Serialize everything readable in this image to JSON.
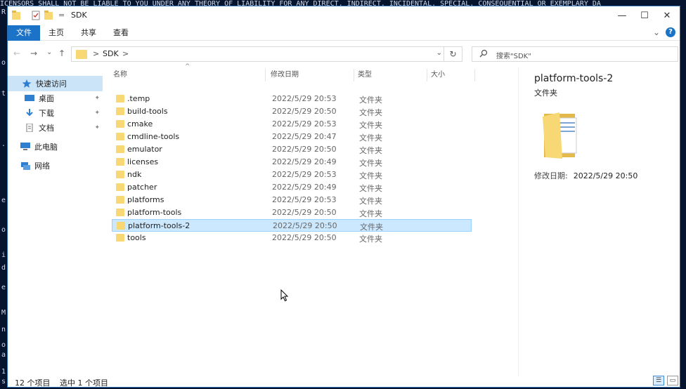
{
  "background_terminal": {
    "line": "ICENSORS SHALL NOT BE LIABLE TO YOU UNDER ANY THEORY OF LIABILITY FOR ANY DIRECT, INDIRECT, INCIDENTAL, SPECIAL, CONSEQUENTIAL OR EXEMPLARY DA",
    "left_chars": [
      "R",
      "o",
      "t",
      ".",
      "e",
      "o",
      "i",
      "d",
      "e",
      "M",
      "n",
      "o",
      "a",
      "1",
      "s"
    ]
  },
  "window": {
    "title": "SDK",
    "minimize": "—",
    "maximize": "☐",
    "close": "✕",
    "qa_dropdown": "="
  },
  "ribbon": {
    "tabs": [
      "文件",
      "主页",
      "共享",
      "查看"
    ],
    "expand_icon": "⌄",
    "help_label": "?"
  },
  "navigation": {
    "back": "←",
    "forward": "→",
    "recent": "⌄",
    "up": "↑",
    "path_sep": ">",
    "path": "SDK",
    "path_sep2": ">",
    "dropdown": "⌄",
    "refresh": "↻",
    "search_placeholder": "搜索\"SDK\""
  },
  "sidebar": {
    "items": [
      {
        "label": "快速访问",
        "icon": "star-icon"
      },
      {
        "label": "桌面",
        "icon": "desktop-icon"
      },
      {
        "label": "下载",
        "icon": "download-icon"
      },
      {
        "label": "文档",
        "icon": "document-icon"
      },
      {
        "label": "此电脑",
        "icon": "computer-icon"
      },
      {
        "label": "网络",
        "icon": "network-icon"
      }
    ]
  },
  "columns": {
    "name": "名称",
    "date": "修改日期",
    "type": "类型",
    "size": "大小",
    "sort_icon": "^"
  },
  "files": [
    {
      "name": ".temp",
      "date": "2022/5/29 20:53",
      "type": "文件夹"
    },
    {
      "name": "build-tools",
      "date": "2022/5/29 20:50",
      "type": "文件夹"
    },
    {
      "name": "cmake",
      "date": "2022/5/29 20:53",
      "type": "文件夹"
    },
    {
      "name": "cmdline-tools",
      "date": "2022/5/29 20:47",
      "type": "文件夹"
    },
    {
      "name": "emulator",
      "date": "2022/5/29 20:50",
      "type": "文件夹"
    },
    {
      "name": "licenses",
      "date": "2022/5/29 20:49",
      "type": "文件夹"
    },
    {
      "name": "ndk",
      "date": "2022/5/29 20:53",
      "type": "文件夹"
    },
    {
      "name": "patcher",
      "date": "2022/5/29 20:49",
      "type": "文件夹"
    },
    {
      "name": "platforms",
      "date": "2022/5/29 20:53",
      "type": "文件夹"
    },
    {
      "name": "platform-tools",
      "date": "2022/5/29 20:50",
      "type": "文件夹"
    },
    {
      "name": "platform-tools-2",
      "date": "2022/5/29 20:50",
      "type": "文件夹",
      "selected": true
    },
    {
      "name": "tools",
      "date": "2022/5/29 20:50",
      "type": "文件夹"
    }
  ],
  "preview": {
    "name": "platform-tools-2",
    "type": "文件夹",
    "meta_label": "修改日期:",
    "meta_value": "2022/5/29 20:50"
  },
  "status": {
    "count": "12 个项目",
    "selected": "选中 1 个项目"
  },
  "colors": {
    "accent": "#1a73c7",
    "selection": "#cce8ff",
    "folder": "#f8d775"
  }
}
